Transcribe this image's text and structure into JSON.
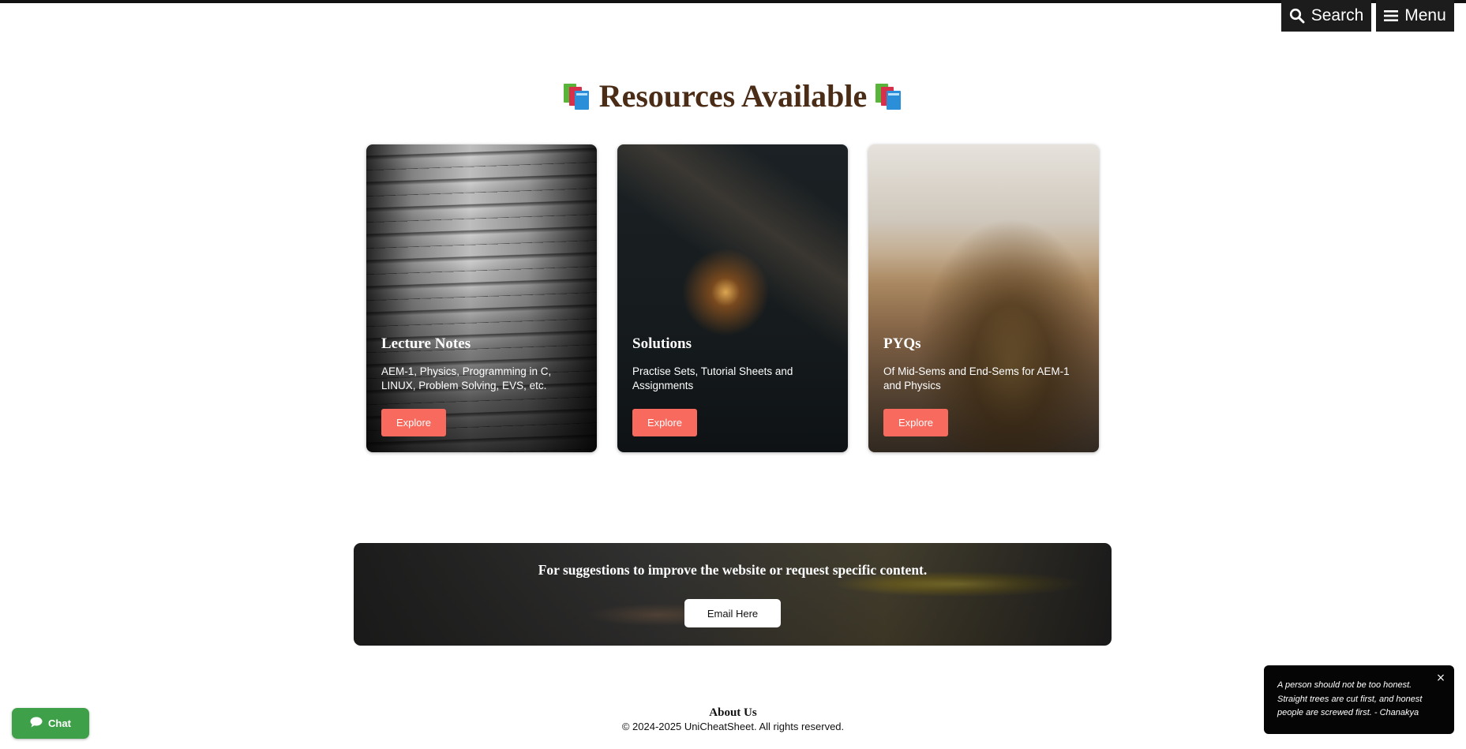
{
  "header": {
    "search_label": "Search",
    "menu_label": "Menu"
  },
  "resources": {
    "title": "Resources Available",
    "cards": [
      {
        "title": "Lecture Notes",
        "description": "AEM-1, Physics, Programming in C, LINUX, Problem Solving, EVS, etc.",
        "button": "Explore"
      },
      {
        "title": "Solutions",
        "description": "Practise Sets, Tutorial Sheets and Assignments",
        "button": "Explore"
      },
      {
        "title": "PYQs",
        "description": "Of Mid-Sems and End-Sems for AEM-1 and Physics",
        "button": "Explore"
      }
    ]
  },
  "suggestions": {
    "text": "For suggestions to improve the website or request specific content.",
    "button": "Email Here"
  },
  "footer": {
    "about": "About Us",
    "copyright": "© 2024-2025 UniCheatSheet. All rights reserved."
  },
  "chat": {
    "label": "Chat"
  },
  "quote": {
    "text": "A person should not be too honest. Straight trees are cut first, and honest people are screwed first. - Chanakya",
    "close": "×"
  },
  "colors": {
    "heading": "#4a2c17",
    "explore_button": "#f86a5e",
    "chat_button": "#3fa04a",
    "top_buttons": "#1c1c1c"
  },
  "icons": {
    "search": "search-icon",
    "menu": "hamburger-menu-icon",
    "books": "books-icon",
    "chat": "chat-bubble-icon",
    "close": "close-icon"
  }
}
